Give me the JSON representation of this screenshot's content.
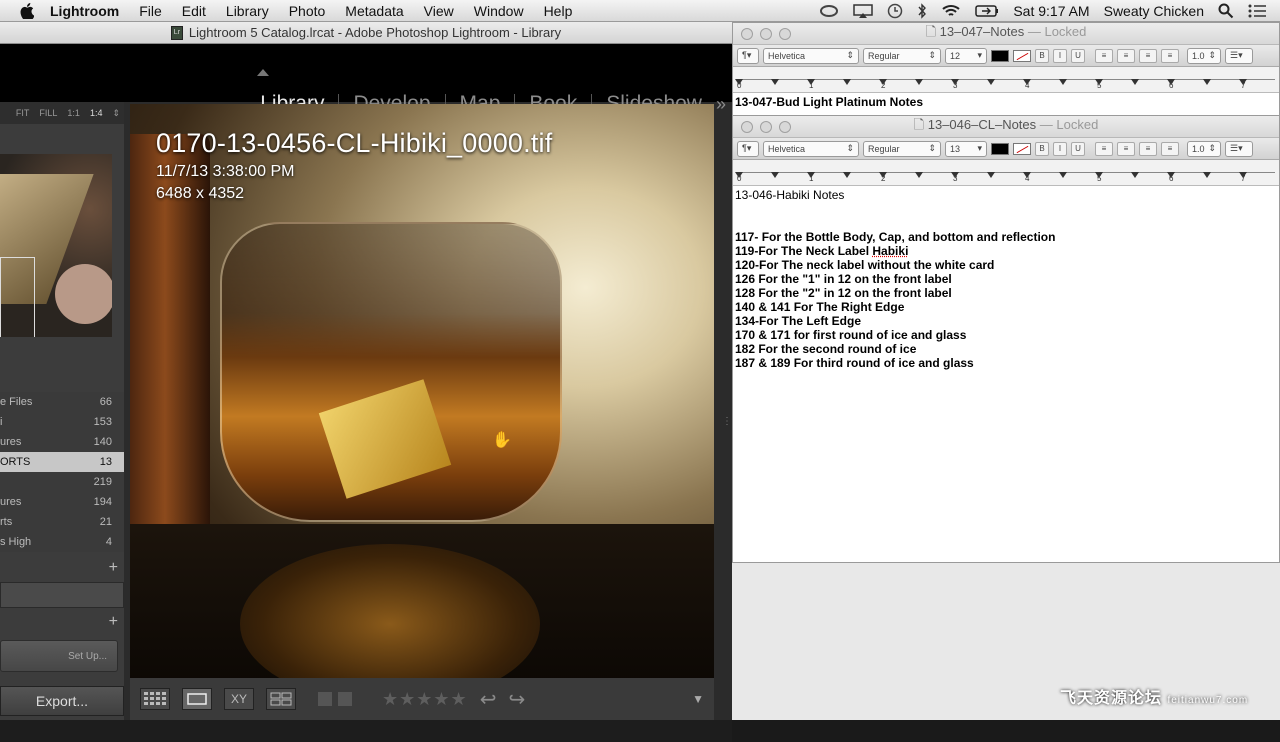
{
  "menubar": {
    "app": "Lightroom",
    "items": [
      "File",
      "Edit",
      "Library",
      "Photo",
      "Metadata",
      "View",
      "Window",
      "Help"
    ],
    "clock": "Sat 9:17 AM",
    "user": "Sweaty Chicken"
  },
  "lightroom": {
    "window_title": "Lightroom 5 Catalog.lrcat - Adobe Photoshop Lightroom - Library",
    "modules": [
      "Library",
      "Develop",
      "Map",
      "Book",
      "Slideshow"
    ],
    "more": "»",
    "navigator": {
      "fit": "FIT",
      "fill": "FILL",
      "one": "1:1",
      "quarter": "1:4"
    },
    "collections": [
      {
        "name": "e Files",
        "count": "66"
      },
      {
        "name": "i",
        "count": "153"
      },
      {
        "name": "ures",
        "count": "140"
      },
      {
        "name": "ORTS",
        "count": "13"
      },
      {
        "name": "",
        "count": "219"
      },
      {
        "name": "ures",
        "count": "194"
      },
      {
        "name": "rts",
        "count": "21"
      },
      {
        "name": "s High",
        "count": "4"
      }
    ],
    "plus": "+",
    "setup_label": "Set Up...",
    "export_label": "Export...",
    "photo": {
      "filename": "0170-13-0456-CL-Hibiki_0000.tif",
      "date": "11/7/13 3:38:00 PM",
      "dimensions": "6488 x 4352"
    },
    "toolbar": {
      "stars": "★★★★★",
      "xy": "XY"
    }
  },
  "textedit_back": {
    "title": "13–047–Notes",
    "locked": "— Locked",
    "font": "Helvetica",
    "style": "Regular",
    "size": "12",
    "spacing": "1.0",
    "first_line": "13-047-Bud Light Platinum Notes"
  },
  "textedit_front": {
    "title": "13–046–CL–Notes",
    "locked": "— Locked",
    "font": "Helvetica",
    "style": "Regular",
    "size": "13",
    "spacing": "1.0",
    "heading": "13-046-Habiki Notes",
    "lines": [
      "117- For the Bottle Body, Cap, and bottom and reflection",
      "119-For The Neck Label Habiki",
      "120-For The neck label without the white card",
      "126 For the \"1\" in 12 on the front label",
      "128 For the \"2\" in 12 on the front label",
      "140 & 141 For The Right Edge",
      "134-For The Left Edge",
      "170 & 171 for first round of ice and glass",
      "182 For the second round of ice",
      "187 & 189 For third round of ice and glass"
    ]
  },
  "ruler_numbers": [
    "0",
    "1",
    "2",
    "3",
    "4",
    "5",
    "6",
    "7"
  ],
  "watermark": {
    "cn": "飞天资源论坛",
    "url": "feitianwu7.com"
  }
}
